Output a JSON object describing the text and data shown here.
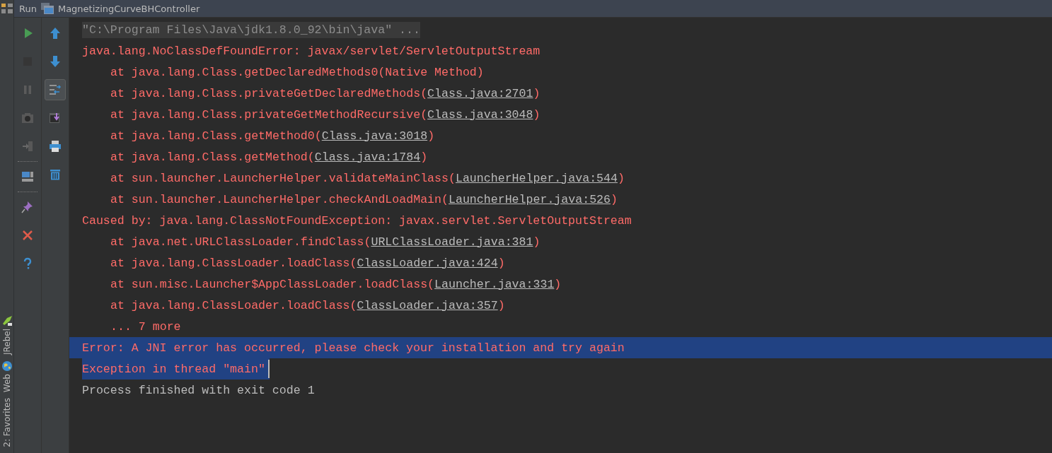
{
  "side_tabs": [
    {
      "label": "JRebel",
      "kind": "jrebel"
    },
    {
      "label": "Web",
      "kind": "web"
    },
    {
      "label": "2: Favorites",
      "kind": "favorites"
    }
  ],
  "title_bar": {
    "label": "Run",
    "config": "MagnetizingCurveBHController"
  },
  "toolbar_left": [
    {
      "kind": "run",
      "disabled": false
    },
    {
      "kind": "stop",
      "disabled": true
    },
    {
      "kind": "pause",
      "disabled": true
    },
    {
      "kind": "camera",
      "disabled": true
    },
    {
      "kind": "exit",
      "disabled": true
    },
    {
      "kind": "separator"
    },
    {
      "kind": "layout",
      "disabled": false
    },
    {
      "kind": "separator"
    },
    {
      "kind": "pin",
      "disabled": false
    },
    {
      "kind": "close",
      "disabled": false
    },
    {
      "kind": "help",
      "disabled": false
    }
  ],
  "toolbar_right": [
    {
      "kind": "up",
      "on": false
    },
    {
      "kind": "down",
      "on": false
    },
    {
      "kind": "wrap",
      "on": true
    },
    {
      "kind": "scrollend",
      "on": false
    },
    {
      "kind": "print",
      "on": false
    },
    {
      "kind": "trash",
      "on": false
    }
  ],
  "console": [
    {
      "kind": "command",
      "text": "\"C:\\Program Files\\Java\\jdk1.8.0_92\\bin\\java\" ...",
      "selected": false,
      "caret": false
    },
    {
      "kind": "error",
      "text": "java.lang.NoClassDefFoundError: javax/servlet/ServletOutputStream",
      "selected": false,
      "caret": false
    },
    {
      "kind": "frame",
      "text": "at java.lang.Class.getDeclaredMethods0(Native Method)",
      "selected": false,
      "caret": false
    },
    {
      "kind": "frame",
      "text": "at java.lang.Class.privateGetDeclaredMethods(",
      "link": "Class.java:2701",
      "after": ")",
      "selected": false,
      "caret": false
    },
    {
      "kind": "frame",
      "text": "at java.lang.Class.privateGetMethodRecursive(",
      "link": "Class.java:3048",
      "after": ")",
      "selected": false,
      "caret": false
    },
    {
      "kind": "frame",
      "text": "at java.lang.Class.getMethod0(",
      "link": "Class.java:3018",
      "after": ")",
      "selected": false,
      "caret": false
    },
    {
      "kind": "frame",
      "text": "at java.lang.Class.getMethod(",
      "link": "Class.java:1784",
      "after": ")",
      "selected": false,
      "caret": false
    },
    {
      "kind": "frame",
      "text": "at sun.launcher.LauncherHelper.validateMainClass(",
      "link": "LauncherHelper.java:544",
      "after": ")",
      "selected": false,
      "caret": false
    },
    {
      "kind": "frame",
      "text": "at sun.launcher.LauncherHelper.checkAndLoadMain(",
      "link": "LauncherHelper.java:526",
      "after": ")",
      "selected": false,
      "caret": false
    },
    {
      "kind": "error",
      "text": "Caused by: java.lang.ClassNotFoundException: javax.servlet.ServletOutputStream",
      "selected": false,
      "caret": false
    },
    {
      "kind": "frame",
      "text": "at java.net.URLClassLoader.findClass(",
      "link": "URLClassLoader.java:381",
      "after": ")",
      "selected": false,
      "caret": false
    },
    {
      "kind": "frame",
      "text": "at java.lang.ClassLoader.loadClass(",
      "link": "ClassLoader.java:424",
      "after": ")",
      "selected": false,
      "caret": false
    },
    {
      "kind": "frame",
      "text": "at sun.misc.Launcher$AppClassLoader.loadClass(",
      "link": "Launcher.java:331",
      "after": ")",
      "selected": false,
      "caret": false
    },
    {
      "kind": "frame",
      "text": "at java.lang.ClassLoader.loadClass(",
      "link": "ClassLoader.java:357",
      "after": ")",
      "selected": false,
      "caret": false
    },
    {
      "kind": "frame",
      "text": "... 7 more",
      "selected": false,
      "caret": false
    },
    {
      "kind": "error",
      "text": "Error: A JNI error has occurred, please check your installation and try again",
      "selected": true,
      "caret": false
    },
    {
      "kind": "error",
      "text": "Exception in thread \"main\"",
      "selected": true,
      "caret": true
    },
    {
      "kind": "info",
      "text": "Process finished with exit code 1",
      "selected": false,
      "caret": false
    }
  ]
}
